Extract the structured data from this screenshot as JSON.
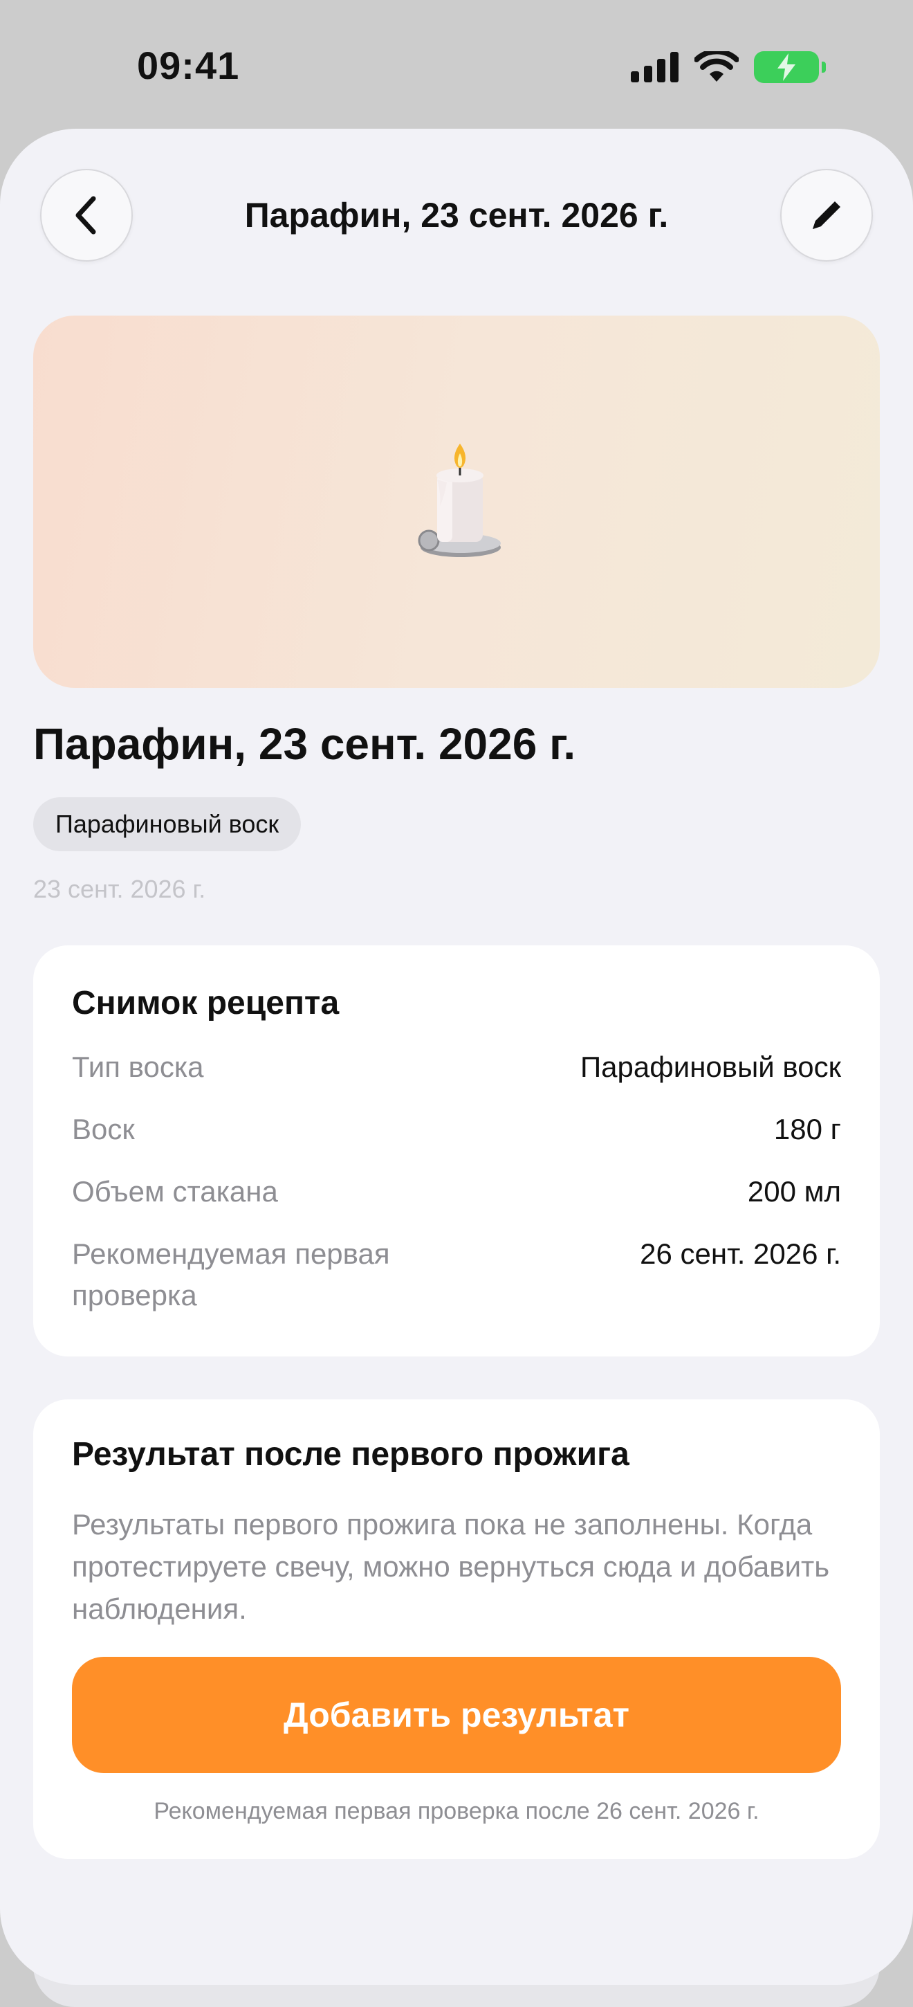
{
  "status_bar": {
    "time": "09:41"
  },
  "nav": {
    "title": "Парафин, 23 сент. 2026 г."
  },
  "hero": {
    "emoji": "🕯️"
  },
  "header": {
    "title": "Парафин, 23 сент. 2026 г.",
    "chip": "Парафиновый воск",
    "date": "23 сент. 2026 г."
  },
  "recipe": {
    "title": "Снимок рецепта",
    "rows": [
      {
        "label": "Тип воска",
        "value": "Парафиновый воск"
      },
      {
        "label": "Воск",
        "value": "180 г"
      },
      {
        "label": "Объем стакана",
        "value": "200 мл"
      },
      {
        "label": "Рекомендуемая первая проверка",
        "value": "26 сент. 2026 г."
      }
    ]
  },
  "result": {
    "title": "Результат после первого прожига",
    "text": "Результаты первого прожига пока не заполнены. Когда протестируете свечу, можно вернуться сюда и добавить наблюдения.",
    "button": "Добавить результат",
    "hint": "Рекомендуемая первая проверка после 26 сент. 2026 г."
  },
  "colors": {
    "accent": "#ff8f28",
    "battery": "#3ccf5a"
  }
}
